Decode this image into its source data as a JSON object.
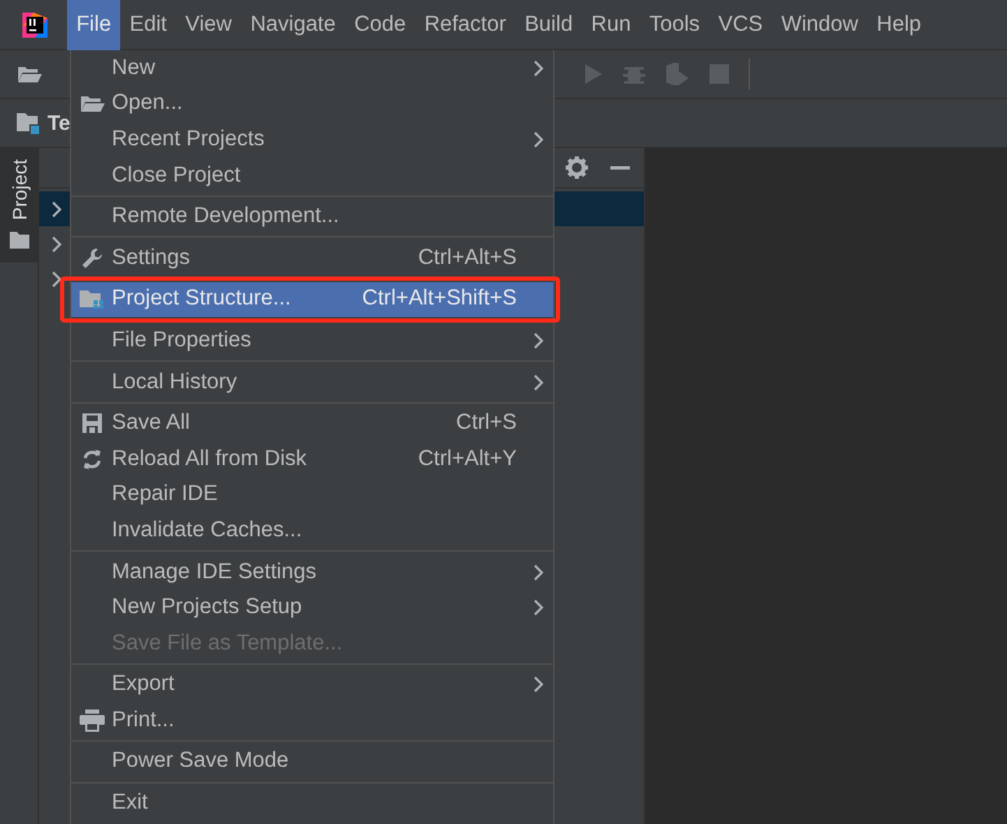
{
  "menu_bar": {
    "items": [
      {
        "label": "File",
        "selected": true
      },
      {
        "label": "Edit",
        "selected": false
      },
      {
        "label": "View",
        "selected": false
      },
      {
        "label": "Navigate",
        "selected": false
      },
      {
        "label": "Code",
        "selected": false
      },
      {
        "label": "Refactor",
        "selected": false
      },
      {
        "label": "Build",
        "selected": false
      },
      {
        "label": "Run",
        "selected": false
      },
      {
        "label": "Tools",
        "selected": false
      },
      {
        "label": "VCS",
        "selected": false
      },
      {
        "label": "Window",
        "selected": false
      },
      {
        "label": "Help",
        "selected": false
      }
    ]
  },
  "navigation_bar": {
    "label": "Te"
  },
  "tool_stripe": {
    "tabs": [
      {
        "label": "Project",
        "selected": true
      }
    ]
  },
  "project_panel": {
    "rows": [
      {
        "selected": true,
        "expanded": false
      },
      {
        "selected": false,
        "expanded": false
      },
      {
        "selected": false,
        "expanded": false
      }
    ]
  },
  "file_menu": {
    "items": [
      {
        "kind": "item",
        "label": "New",
        "submenu": true,
        "selected": false,
        "disabled": false
      },
      {
        "kind": "item",
        "label": "Open...",
        "selected": false,
        "disabled": false
      },
      {
        "kind": "item",
        "label": "Recent Projects",
        "submenu": true,
        "selected": false,
        "disabled": false
      },
      {
        "kind": "item",
        "label": "Close Project",
        "selected": false,
        "disabled": false
      },
      {
        "kind": "separator"
      },
      {
        "kind": "item",
        "label": "Remote Development...",
        "selected": false,
        "disabled": false
      },
      {
        "kind": "separator"
      },
      {
        "kind": "item",
        "label": "Settings",
        "shortcut": "Ctrl+Alt+S",
        "selected": false,
        "disabled": false
      },
      {
        "kind": "item",
        "label": "Project Structure...",
        "shortcut": "Ctrl+Alt+Shift+S",
        "selected": true,
        "disabled": false,
        "highlighted": true
      },
      {
        "kind": "item",
        "label": "File Properties",
        "submenu": true,
        "selected": false,
        "disabled": false
      },
      {
        "kind": "separator"
      },
      {
        "kind": "item",
        "label": "Local History",
        "submenu": true,
        "selected": false,
        "disabled": false
      },
      {
        "kind": "separator"
      },
      {
        "kind": "item",
        "label": "Save All",
        "shortcut": "Ctrl+S",
        "selected": false,
        "disabled": false
      },
      {
        "kind": "item",
        "label": "Reload All from Disk",
        "shortcut": "Ctrl+Alt+Y",
        "selected": false,
        "disabled": false
      },
      {
        "kind": "item",
        "label": "Repair IDE",
        "selected": false,
        "disabled": false
      },
      {
        "kind": "item",
        "label": "Invalidate Caches...",
        "selected": false,
        "disabled": false
      },
      {
        "kind": "separator"
      },
      {
        "kind": "item",
        "label": "Manage IDE Settings",
        "submenu": true,
        "selected": false,
        "disabled": false
      },
      {
        "kind": "item",
        "label": "New Projects Setup",
        "submenu": true,
        "selected": false,
        "disabled": false
      },
      {
        "kind": "item",
        "label": "Save File as Template...",
        "selected": false,
        "disabled": true
      },
      {
        "kind": "separator"
      },
      {
        "kind": "item",
        "label": "Export",
        "submenu": true,
        "selected": false,
        "disabled": false
      },
      {
        "kind": "item",
        "label": "Print...",
        "selected": false,
        "disabled": false
      },
      {
        "kind": "separator"
      },
      {
        "kind": "item",
        "label": "Power Save Mode",
        "selected": false,
        "disabled": false
      },
      {
        "kind": "separator"
      },
      {
        "kind": "item",
        "label": "Exit",
        "selected": false,
        "disabled": false
      }
    ]
  }
}
